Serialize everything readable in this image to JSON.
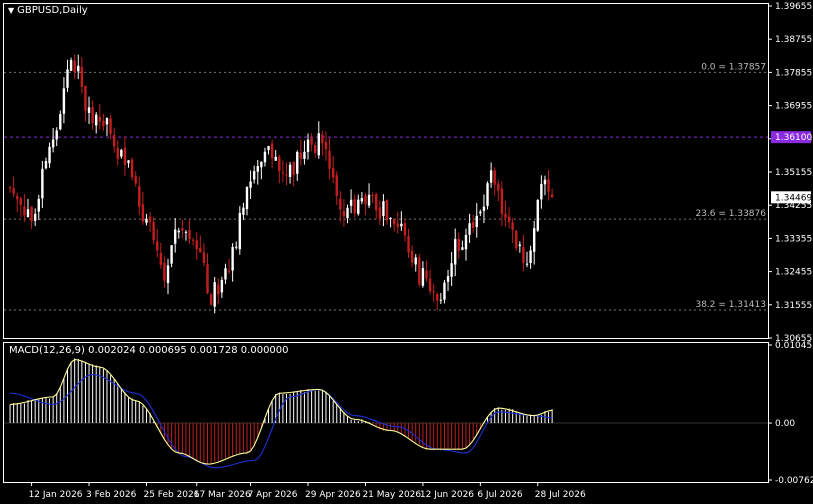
{
  "header": {
    "symbol": "GBPUSD,Daily",
    "macd_label": "MACD(12,26,9) 0.002024 0.000695 0.001728 0.000000"
  },
  "colors": {
    "background": "#000000",
    "axis": "#ffffff",
    "bull_candle": "#ffffff",
    "bear_candle": "#c41e1e",
    "price_line": "#8a2be2",
    "dotted_level": "#777777",
    "macd_main": "#ffff99",
    "macd_signal": "#1e2fd6",
    "hist_pos": "#ffffff",
    "hist_neg": "#c41e1e"
  },
  "chart_data": [
    {
      "type": "candlestick",
      "title": "GBPUSD,Daily",
      "ylim": [
        1.30655,
        1.39655
      ],
      "y_ticks": [
        "1.39655",
        "1.38755",
        "1.37855",
        "1.36955",
        "1.36055",
        "1.35155",
        "1.34255",
        "1.33355",
        "1.32455",
        "1.31555",
        "1.30655"
      ],
      "x_ticks": [
        "12 Jan 2026",
        "3 Feb 2026",
        "25 Feb 2026",
        "17 Mar 2026",
        "7 Apr 2026",
        "29 Apr 2026",
        "21 May 2026",
        "12 Jun 2026",
        "6 Jul 2026",
        "28 Jul 2026"
      ],
      "current_price": "1.34469",
      "price_line": "1.36100",
      "fib_levels": [
        {
          "label": "0.0 = 1.37857",
          "value": 1.37857
        },
        {
          "label": "23.6 = 1.33876",
          "value": 1.33876
        },
        {
          "label": "38.2 = 1.31413",
          "value": 1.31413
        }
      ],
      "keypoints": [
        {
          "date": "2 Jan 2026",
          "price": 1.346
        },
        {
          "date": "12 Jan 2026",
          "price": 1.339
        },
        {
          "date": "20 Jan 2026",
          "price": 1.362
        },
        {
          "date": "27 Jan 2026",
          "price": 1.383
        },
        {
          "date": "3 Feb 2026",
          "price": 1.368
        },
        {
          "date": "10 Feb 2026",
          "price": 1.364
        },
        {
          "date": "18 Feb 2026",
          "price": 1.352
        },
        {
          "date": "25 Feb 2026",
          "price": 1.338
        },
        {
          "date": "4 Mar 2026",
          "price": 1.325
        },
        {
          "date": "10 Mar 2026",
          "price": 1.338
        },
        {
          "date": "17 Mar 2026",
          "price": 1.33
        },
        {
          "date": "23 Mar 2026",
          "price": 1.318
        },
        {
          "date": "30 Mar 2026",
          "price": 1.327
        },
        {
          "date": "7 Apr 2026",
          "price": 1.348
        },
        {
          "date": "14 Apr 2026",
          "price": 1.356
        },
        {
          "date": "21 Apr 2026",
          "price": 1.35
        },
        {
          "date": "29 Apr 2026",
          "price": 1.36
        },
        {
          "date": "5 May 2026",
          "price": 1.359
        },
        {
          "date": "12 May 2026",
          "price": 1.342
        },
        {
          "date": "21 May 2026",
          "price": 1.344
        },
        {
          "date": "28 May 2026",
          "price": 1.341
        },
        {
          "date": "4 Jun 2026",
          "price": 1.336
        },
        {
          "date": "12 Jun 2026",
          "price": 1.323
        },
        {
          "date": "18 Jun 2026",
          "price": 1.318
        },
        {
          "date": "26 Jun 2026",
          "price": 1.332
        },
        {
          "date": "6 Jul 2026",
          "price": 1.34
        },
        {
          "date": "9 Jul 2026",
          "price": 1.352
        },
        {
          "date": "16 Jul 2026",
          "price": 1.335
        },
        {
          "date": "23 Jul 2026",
          "price": 1.329
        },
        {
          "date": "30 Jul 2026",
          "price": 1.348
        },
        {
          "date": "3 Aug 2026",
          "price": 1.3447
        }
      ]
    },
    {
      "type": "macd",
      "title": "MACD(12,26,9) 0.002024 0.000695 0.001728 0.000000",
      "ylim": [
        -0.007627,
        0.01045
      ],
      "y_ticks": [
        "0.01045",
        "0.00",
        "-0.007627"
      ],
      "main_keypoints": [
        {
          "date": "2 Jan 2026",
          "value": 0.0025
        },
        {
          "date": "20 Jan 2026",
          "value": 0.0035
        },
        {
          "date": "28 Jan 2026",
          "value": 0.0085
        },
        {
          "date": "6 Feb 2026",
          "value": 0.0075
        },
        {
          "date": "20 Feb 2026",
          "value": 0.003
        },
        {
          "date": "10 Mar 2026",
          "value": -0.004
        },
        {
          "date": "20 Mar 2026",
          "value": -0.0055
        },
        {
          "date": "6 Apr 2026",
          "value": -0.004
        },
        {
          "date": "17 Apr 2026",
          "value": 0.004
        },
        {
          "date": "4 May 2026",
          "value": 0.0045
        },
        {
          "date": "18 May 2026",
          "value": 0.0005
        },
        {
          "date": "1 Jun 2026",
          "value": -0.001
        },
        {
          "date": "16 Jun 2026",
          "value": -0.0035
        },
        {
          "date": "28 Jun 2026",
          "value": -0.0035
        },
        {
          "date": "11 Jul 2026",
          "value": 0.002
        },
        {
          "date": "25 Jul 2026",
          "value": 0.001
        },
        {
          "date": "3 Aug 2026",
          "value": 0.0017
        }
      ],
      "signal_keypoints": [
        {
          "date": "2 Jan 2026",
          "value": 0.004
        },
        {
          "date": "20 Jan 2026",
          "value": 0.0025
        },
        {
          "date": "4 Feb 2026",
          "value": 0.0065
        },
        {
          "date": "20 Feb 2026",
          "value": 0.004
        },
        {
          "date": "12 Mar 2026",
          "value": -0.0045
        },
        {
          "date": "24 Mar 2026",
          "value": -0.006
        },
        {
          "date": "8 Apr 2026",
          "value": -0.005
        },
        {
          "date": "22 Apr 2026",
          "value": 0.0035
        },
        {
          "date": "4 May 2026",
          "value": 0.0045
        },
        {
          "date": "18 May 2026",
          "value": 0.001
        },
        {
          "date": "3 Jun 2026",
          "value": -0.0005
        },
        {
          "date": "18 Jun 2026",
          "value": -0.0035
        },
        {
          "date": "30 Jun 2026",
          "value": -0.004
        },
        {
          "date": "13 Jul 2026",
          "value": 0.0015
        },
        {
          "date": "27 Jul 2026",
          "value": 0.001
        },
        {
          "date": "3 Aug 2026",
          "value": 0.0007
        }
      ]
    }
  ]
}
